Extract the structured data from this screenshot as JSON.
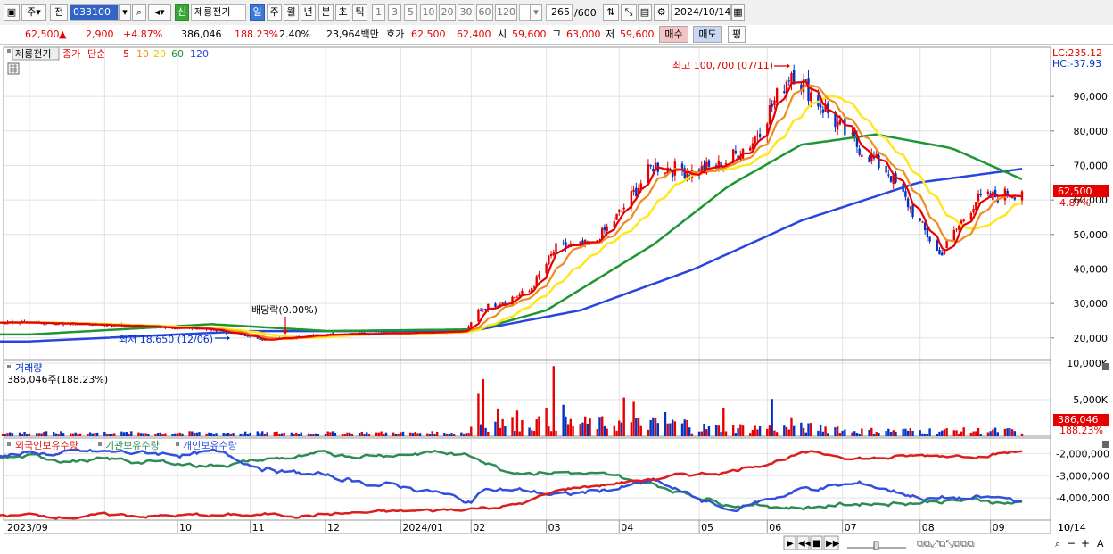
{
  "toolbar": {
    "market_label": "주",
    "prev_label": "전",
    "stock_code": "033100",
    "stock_badge": "신",
    "stock_name": "제룡전기",
    "period_tabs": [
      "일",
      "주",
      "월",
      "년",
      "분",
      "초",
      "틱"
    ],
    "minute_options": [
      "1",
      "3",
      "5",
      "10",
      "20",
      "30",
      "60",
      "120"
    ],
    "bar_count": "265",
    "bar_total": "/600",
    "date": "2024/10/14"
  },
  "quote": {
    "price": "62,500",
    "change_arrow": "▲",
    "change": "2,900",
    "change_pct": "+4.87%",
    "volume": "386,046",
    "volume_ratio": "188.23%",
    "turnover": "2.40%",
    "amount": "23,964백만",
    "quote_label": "호가",
    "ask": "62,500",
    "bid": "62,400",
    "open_label": "시",
    "open": "59,600",
    "high_label": "고",
    "high": "63,000",
    "low_label": "저",
    "low": "59,600",
    "buy_button": "매수",
    "sell_button": "매도",
    "eval_button": "평"
  },
  "colors": {
    "up": "#e60000",
    "down": "#0032c8",
    "ma5": "#e60000",
    "ma10": "#f08c1e",
    "ma20": "#ffe61e",
    "ma60": "#1e9632",
    "ma120": "#2846dc",
    "foreign": "#dc1e1e",
    "institution": "#2d8c55",
    "individual": "#3250dc"
  },
  "chart_data": [
    {
      "type": "candlestick",
      "title": "제룡전기",
      "legend_price_label": "종가",
      "legend_ma_label": "단순",
      "ma_periods": [
        5,
        10,
        20,
        60,
        120
      ],
      "x_tick_labels": [
        "2023/09",
        "10",
        "11",
        "12",
        "2024/01",
        "02",
        "03",
        "04",
        "05",
        "06",
        "07",
        "08",
        "09",
        "10",
        "10/14"
      ],
      "y_tick_labels": [
        "20,000",
        "30,000",
        "40,000",
        "50,000",
        "60,000",
        "70,000",
        "80,000",
        "90,000"
      ],
      "y_range": [
        14000,
        104000
      ],
      "lc": "LC:235.12",
      "hc": "HC:-37.93",
      "last_price_label": "62,500",
      "last_change_label": "4.87%",
      "annotations": {
        "high": "최고 100,700 (07/11)",
        "low": "최저 18,650 (12/06)",
        "dividend": "배당락(0.00%)"
      },
      "close_anchors": [
        [
          "2023-09-01",
          24500
        ],
        [
          "2023-10-15",
          23500
        ],
        [
          "2023-11-15",
          22500
        ],
        [
          "2023-12-06",
          19500
        ],
        [
          "2024-01-02",
          21000
        ],
        [
          "2024-02-01",
          21500
        ],
        [
          "2024-02-28",
          22000
        ],
        [
          "2024-03-04",
          28000
        ],
        [
          "2024-03-25",
          33500
        ],
        [
          "2024-04-05",
          46000
        ],
        [
          "2024-04-20",
          47000
        ],
        [
          "2024-04-30",
          55000
        ],
        [
          "2024-05-15",
          70000
        ],
        [
          "2024-05-31",
          68000
        ],
        [
          "2024-06-12",
          70000
        ],
        [
          "2024-06-25",
          77000
        ],
        [
          "2024-07-11",
          97500
        ],
        [
          "2024-07-25",
          86000
        ],
        [
          "2024-08-05",
          77000
        ],
        [
          "2024-08-20",
          68000
        ],
        [
          "2024-09-10",
          44000
        ],
        [
          "2024-09-25",
          60000
        ],
        [
          "2024-10-14",
          62500
        ]
      ],
      "ma60_anchors": [
        [
          "2023-09-01",
          21000
        ],
        [
          "2023-11-15",
          24000
        ],
        [
          "2024-01-02",
          22000
        ],
        [
          "2024-03-04",
          22500
        ],
        [
          "2024-04-01",
          28000
        ],
        [
          "2024-05-15",
          47000
        ],
        [
          "2024-06-15",
          64000
        ],
        [
          "2024-07-15",
          76000
        ],
        [
          "2024-08-15",
          79000
        ],
        [
          "2024-09-15",
          75000
        ],
        [
          "2024-10-14",
          66000
        ]
      ],
      "ma120_anchors": [
        [
          "2023-09-01",
          19000
        ],
        [
          "2023-12-01",
          22000
        ],
        [
          "2024-03-01",
          22000
        ],
        [
          "2024-04-15",
          28000
        ],
        [
          "2024-06-01",
          40000
        ],
        [
          "2024-07-15",
          54000
        ],
        [
          "2024-09-01",
          65000
        ],
        [
          "2024-10-14",
          69000
        ]
      ]
    },
    {
      "type": "bar",
      "title": "거래량",
      "summary": "386,046주(188.23%)",
      "y_tick_labels": [
        "10,000K",
        "5,000K"
      ],
      "y_range": [
        0,
        10000
      ],
      "unit": "K",
      "last_value_label": "386,046",
      "last_ratio_label": "188.23%",
      "spikes": [
        [
          "2024-03-04",
          5800
        ],
        [
          "2024-03-06",
          7800
        ],
        [
          "2024-03-12",
          3800
        ],
        [
          "2024-03-20",
          3500
        ],
        [
          "2024-04-01",
          3900
        ],
        [
          "2024-04-04",
          9600
        ],
        [
          "2024-04-08",
          4300
        ],
        [
          "2024-05-03",
          5300
        ],
        [
          "2024-05-07",
          4700
        ],
        [
          "2024-05-20",
          3300
        ],
        [
          "2024-06-13",
          3900
        ],
        [
          "2024-07-03",
          5100
        ],
        [
          "2024-07-11",
          2600
        ]
      ]
    },
    {
      "type": "line",
      "series_labels": [
        "외국인보유수량",
        "기관보유수량",
        "개인보유수량"
      ],
      "y_tick_labels": [
        "-2,000,000",
        "-3,000,000",
        "-4,000,000"
      ],
      "y_range": [
        -5000000,
        -1300000
      ],
      "foreign_anchors": [
        [
          "2023-09-01",
          -4800000
        ],
        [
          "2023-12-01",
          -4800000
        ],
        [
          "2024-02-15",
          -4600000
        ],
        [
          "2024-03-20",
          -4300000
        ],
        [
          "2024-04-10",
          -3600000
        ],
        [
          "2024-05-10",
          -3200000
        ],
        [
          "2024-06-15",
          -2800000
        ],
        [
          "2024-07-15",
          -2000000
        ],
        [
          "2024-08-15",
          -2200000
        ],
        [
          "2024-09-10",
          -2100000
        ],
        [
          "2024-10-14",
          -1900000
        ]
      ],
      "institution_anchors": [
        [
          "2023-09-01",
          -2200000
        ],
        [
          "2023-11-15",
          -2500000
        ],
        [
          "2023-12-15",
          -2200000
        ],
        [
          "2024-02-15",
          -1900000
        ],
        [
          "2024-03-04",
          -2200000
        ],
        [
          "2024-03-15",
          -2700000
        ],
        [
          "2024-04-10",
          -2800000
        ],
        [
          "2024-05-15",
          -3400000
        ],
        [
          "2024-06-15",
          -4200000
        ],
        [
          "2024-07-15",
          -4400000
        ],
        [
          "2024-08-15",
          -4200000
        ],
        [
          "2024-09-10",
          -4100000
        ],
        [
          "2024-10-14",
          -4200000
        ]
      ],
      "individual_anchors": [
        [
          "2023-09-01",
          -2000000
        ],
        [
          "2023-11-15",
          -2000000
        ],
        [
          "2023-12-15",
          -2800000
        ],
        [
          "2024-02-15",
          -3700000
        ],
        [
          "2024-03-01",
          -4300000
        ],
        [
          "2024-03-06",
          -3500000
        ],
        [
          "2024-04-10",
          -3900000
        ],
        [
          "2024-05-15",
          -3300000
        ],
        [
          "2024-06-15",
          -4600000
        ],
        [
          "2024-07-15",
          -3600000
        ],
        [
          "2024-08-10",
          -3400000
        ],
        [
          "2024-09-05",
          -4000000
        ],
        [
          "2024-10-14",
          -4100000
        ]
      ]
    }
  ]
}
